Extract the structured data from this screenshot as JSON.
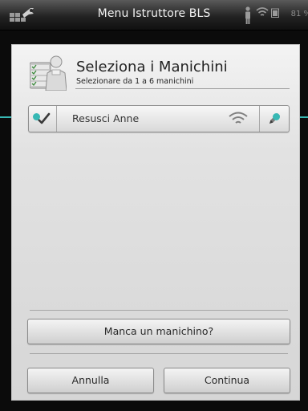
{
  "statusbar": {
    "title": "Menu Istruttore BLS",
    "battery_percent": "81 %",
    "icons": [
      "wrench-tool-icon",
      "person-icon",
      "wifi-icon",
      "battery-icon"
    ]
  },
  "dialog": {
    "title": "Seleziona i Manichini",
    "subtitle": "Selezionare da 1 a 6 manichini",
    "header_icon": "manikin-checklist-icon",
    "manikins": [
      {
        "name": "Resusci Anne",
        "selected": true,
        "connection": "wifi"
      }
    ],
    "missing_button": "Manca un manichino?",
    "cancel_button": "Annulla",
    "continue_button": "Continua"
  },
  "colors": {
    "accent_connector": "#37b8b4",
    "dialog_background": "#dcdcdc",
    "statusbar_background": "#2a2a2a"
  }
}
